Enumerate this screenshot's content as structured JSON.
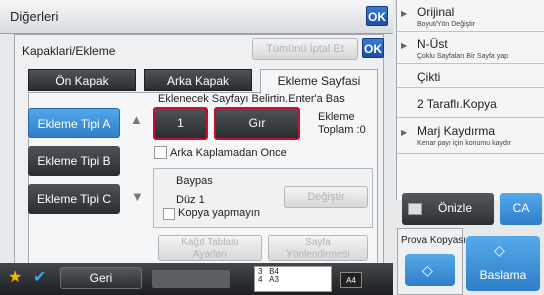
{
  "header": {
    "title": "Diğerleri",
    "ok_label": "OK"
  },
  "dialog": {
    "title": "Kapaklari/Ekleme",
    "ok_label": "OK",
    "cancel_label": "Tümünü İptal Et"
  },
  "tabs": [
    "Ön Kapak",
    "Arka Kapak",
    "Ekleme Sayfasi"
  ],
  "insert_types": [
    "Ekleme Tipi A",
    "Ekleme Tipi B",
    "Ekleme Tipi C"
  ],
  "instruction": "Eklenecek Sayfayı Belirtin.Enter'a Bas",
  "page_number": "1",
  "enter_label": "Gır",
  "insert_total": {
    "line1": "Ekleme",
    "line2": "Toplam :0"
  },
  "no_back_cover": "Arka Kaplamadan Once",
  "bypass": {
    "label": "Baypas",
    "paper": "Düz 1",
    "no_copy": "Kopya yapmayın",
    "change_label": "Değiştir"
  },
  "paper_tray_label": {
    "line1": "Kağıt Tablası",
    "line2": "Ayarları"
  },
  "page_orient_label": {
    "line1": "Sayfa",
    "line2": "Yönlendirmesi"
  },
  "bottom": {
    "back_label": "Geri",
    "tray1": "3",
    "tray1_size": "B4",
    "tray2": "4",
    "tray2_size": "A3",
    "paper_size": "A4"
  },
  "right_menu": [
    {
      "title": "Orijinal",
      "sub": "Boyut/Yön Değiştir"
    },
    {
      "title": "N-Üst",
      "sub": "Çoklu Sayfaları Bir Sayfa yap"
    },
    {
      "title": "Çikti",
      "sub": ""
    },
    {
      "title": "2 Taraflı.Kopya",
      "sub": ""
    },
    {
      "title": "Marj Kaydırma",
      "sub": "Kenar payı için konumu kaydır"
    }
  ],
  "preview_label": "Önizle",
  "ca_label": "CA",
  "proof_label": "Prova Kopyası",
  "start_label": "Baslama",
  "colors": {
    "accent_blue": "#2f7ec9",
    "dark_button": "#2a2d30",
    "highlight_red": "#c8102e"
  },
  "icons": [
    "star-icon",
    "check-icon",
    "arrow-up-icon",
    "arrow-down-icon",
    "preview-icon",
    "start-icon",
    "proof-start-icon"
  ]
}
